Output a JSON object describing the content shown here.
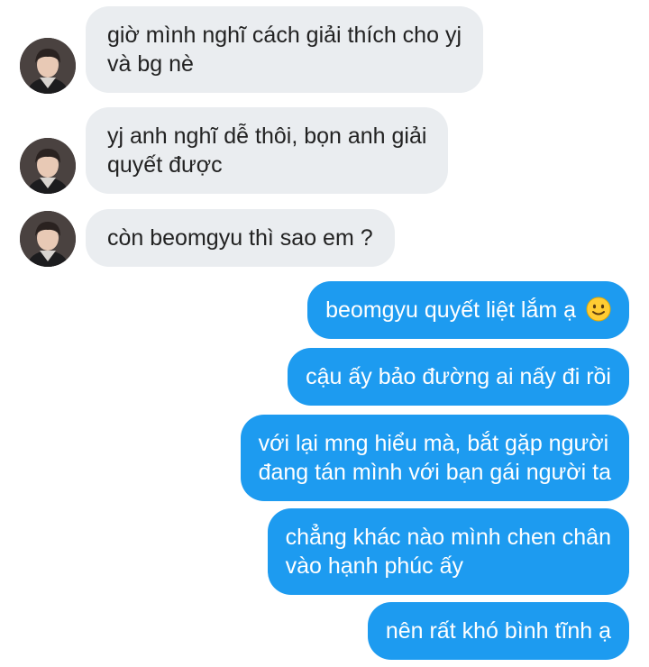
{
  "conversation": {
    "incoming": [
      {
        "lines": [
          "giờ mình nghĩ cách giải thích cho yj",
          "và bg nè"
        ]
      },
      {
        "lines": [
          "yj anh nghĩ dễ thôi, bọn anh giải",
          "quyết được"
        ]
      },
      {
        "lines": [
          "còn beomgyu thì sao em ?"
        ]
      }
    ],
    "outgoing": [
      {
        "lines": [
          "beomgyu quyết liệt lắm ạ"
        ],
        "emoji": "slightly-smiling-face-icon"
      },
      {
        "lines": [
          "cậu ấy bảo đường ai nấy đi rồi"
        ]
      },
      {
        "lines": [
          "với lại mng hiểu mà, bắt gặp người",
          "đang tán mình với bạn gái người ta"
        ]
      },
      {
        "lines": [
          "chẳng khác nào mình chen chân",
          "vào hạnh phúc ấy"
        ]
      },
      {
        "lines": [
          "nên rất khó bình tĩnh ạ"
        ]
      }
    ]
  },
  "colors": {
    "incoming_bubble": "#eaedf0",
    "outgoing_bubble": "#1d9bf0",
    "incoming_text": "#222222",
    "outgoing_text": "#ffffff"
  }
}
